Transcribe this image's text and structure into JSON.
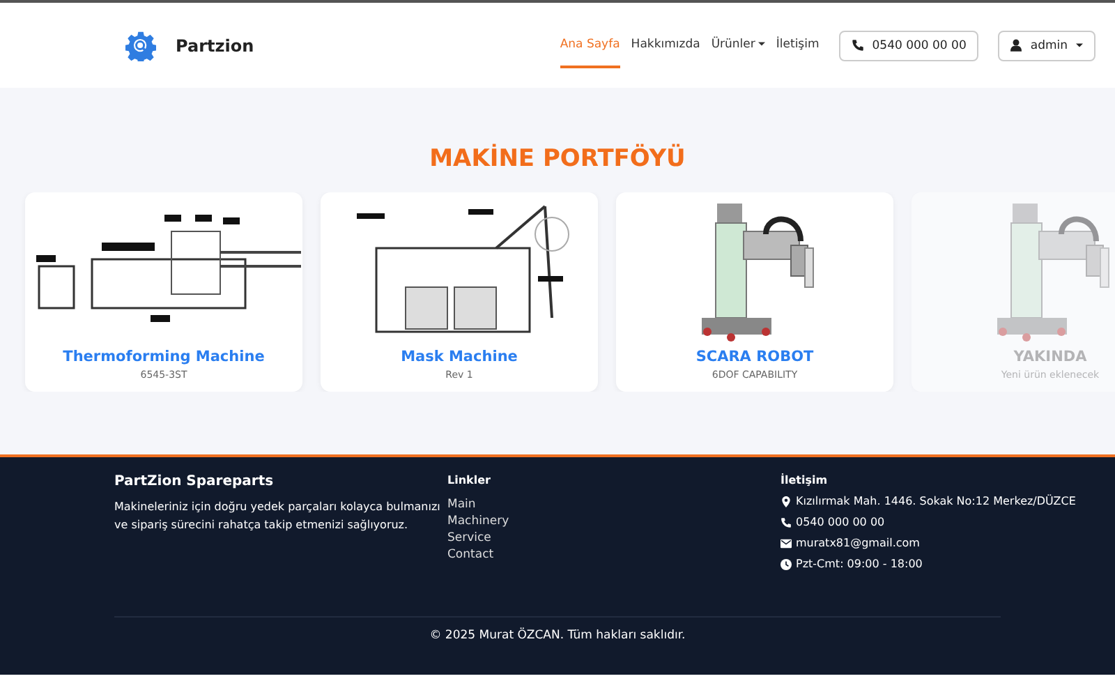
{
  "header": {
    "brand": "Partzion",
    "nav": [
      {
        "label": "Ana Sayfa",
        "selected": true,
        "dropdown": false
      },
      {
        "label": "Hakkımızda",
        "selected": false,
        "dropdown": false
      },
      {
        "label": "Ürünler",
        "selected": false,
        "dropdown": true
      },
      {
        "label": "İletişim",
        "selected": false,
        "dropdown": false
      }
    ],
    "phone_button": "0540 000 00 00",
    "user_menu": "admin"
  },
  "section_title": "MAKİNE PORTFÖYÜ",
  "cards": [
    {
      "kind": "machine",
      "title": "Thermoforming Machine",
      "subtitle": "6545-3ST",
      "disabled": false
    },
    {
      "kind": "frame",
      "title": "Mask Machine",
      "subtitle": "Rev 1",
      "disabled": false
    },
    {
      "kind": "robot",
      "title": "SCARA ROBOT",
      "subtitle": "6DOF CAPABILITY",
      "disabled": false
    },
    {
      "kind": "robot",
      "title": "YAKINDA",
      "subtitle": "Yeni ürün eklenecek",
      "disabled": true
    }
  ],
  "footer": {
    "about": {
      "title": "PartZion Spareparts",
      "text": "Makineleriniz için doğru yedek parçaları kolayca bulmanızı ve sipariş sürecini rahatça takip etmenizi sağlıyoruz."
    },
    "links": {
      "title": "Linkler",
      "items": [
        "Main",
        "Machinery",
        "Service",
        "Contact"
      ]
    },
    "contact": {
      "title": "İletişim",
      "items": [
        {
          "kind": "address",
          "text": "Kızılırmak Mah. 1446. Sokak No:12 Merkez/DÜZCE"
        },
        {
          "kind": "phone",
          "text": "0540 000 00 00"
        },
        {
          "kind": "email",
          "text": "muratx81@gmail.com"
        },
        {
          "kind": "hours",
          "text": "Pzt-Cmt: 09:00 - 18:00"
        }
      ]
    },
    "copyright": "© 2025 Murat ÖZCAN. Tüm hakları saklıdır."
  }
}
